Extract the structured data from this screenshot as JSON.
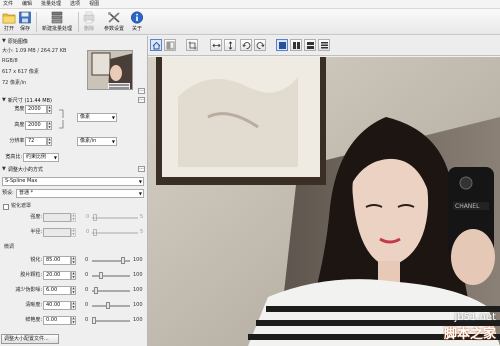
{
  "menu": [
    "文件",
    "编辑",
    "批量处理",
    "选项",
    "视图"
  ],
  "toolbar": {
    "open": "打开",
    "save": "保存",
    "new_batch": "新建批量处理",
    "delete": "删除",
    "settings": "参数设置",
    "about": "关于"
  },
  "panel": {
    "original_header": "原始图像",
    "original_info": [
      "大小: 1.09 MB / 264.27 KB",
      "RGB/8",
      "617 x 617 像素",
      "72 像素/in"
    ],
    "new_size_header": "新尺寸 (11.44 MB)",
    "width_label": "宽度:",
    "width_value": "2000",
    "height_label": "高度:",
    "height_value": "2000",
    "unit_value": "像素",
    "resolution_label": "分辨率:",
    "resolution_value": "72",
    "resolution_unit": "像素/in",
    "aspect_label": "宽高比:",
    "aspect_value": "约束比例",
    "method_header": "调整大小的方式",
    "method_value": "S-Spline Max",
    "preset_label": "预设:",
    "preset_value": "普通 *",
    "crisp_edges_label": "锐化遮罩",
    "strength_label": "强度:",
    "radius_label": "半径:",
    "strength_min": "0",
    "strength_max": "5",
    "radius_min": "0",
    "radius_max": "5",
    "fine_tune_label": "微调",
    "sliders": [
      {
        "label": "锐化:",
        "value": "85.00",
        "min": "0",
        "max": "100",
        "level": 0.85
      },
      {
        "label": "胶片颗粒:",
        "value": "20.00",
        "min": "0",
        "max": "100",
        "level": 0.2
      },
      {
        "label": "减少伪影噪:",
        "value": "6.00",
        "min": "0",
        "max": "100",
        "level": 0.06
      },
      {
        "label": "清晰度:",
        "value": "40.00",
        "min": "0",
        "max": "100",
        "level": 0.4
      },
      {
        "label": "鲜艳度:",
        "value": "0.00",
        "min": "0",
        "max": "100",
        "level": 0.0
      }
    ],
    "bottom_button": "调整大小配置文件..."
  },
  "watermark": {
    "url": "jb51.net",
    "site": "脚本之家"
  }
}
